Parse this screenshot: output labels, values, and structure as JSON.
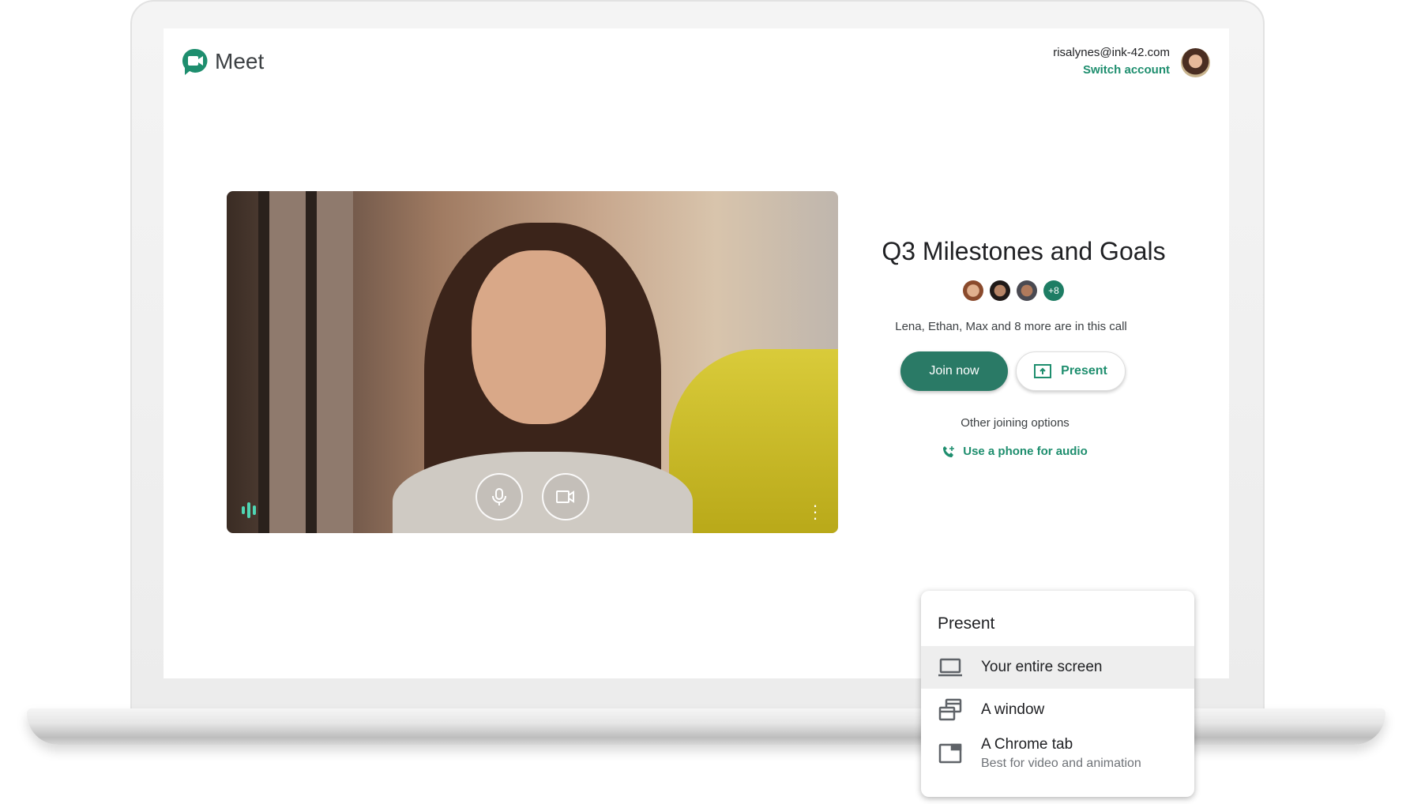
{
  "app": {
    "name": "Meet",
    "brand_color": "#1e8e6e",
    "logo_icon": "meet-logo-icon"
  },
  "account": {
    "email": "risalynes@ink-42.com",
    "switch_label": "Switch account"
  },
  "video": {
    "mic_icon": "microphone-icon",
    "camera_icon": "video-camera-icon",
    "audio_icon": "audio-level-icon",
    "more_icon": "more-vertical-icon"
  },
  "meeting": {
    "title": "Q3 Milestones and Goals",
    "extra_participants": "+8",
    "in_call_text": "Lena, Ethan, Max and 8 more are in this call"
  },
  "actions": {
    "join_label": "Join now",
    "present_label": "Present",
    "other_options": "Other joining options",
    "phone_audio": "Use a phone for audio"
  },
  "present_menu": {
    "title": "Present",
    "items": [
      {
        "label": "Your entire screen",
        "icon": "laptop-icon",
        "highlighted": true
      },
      {
        "label": "A window",
        "icon": "window-icon"
      },
      {
        "label": "A Chrome tab",
        "sub": "Best for video and animation",
        "icon": "tab-icon"
      }
    ]
  }
}
